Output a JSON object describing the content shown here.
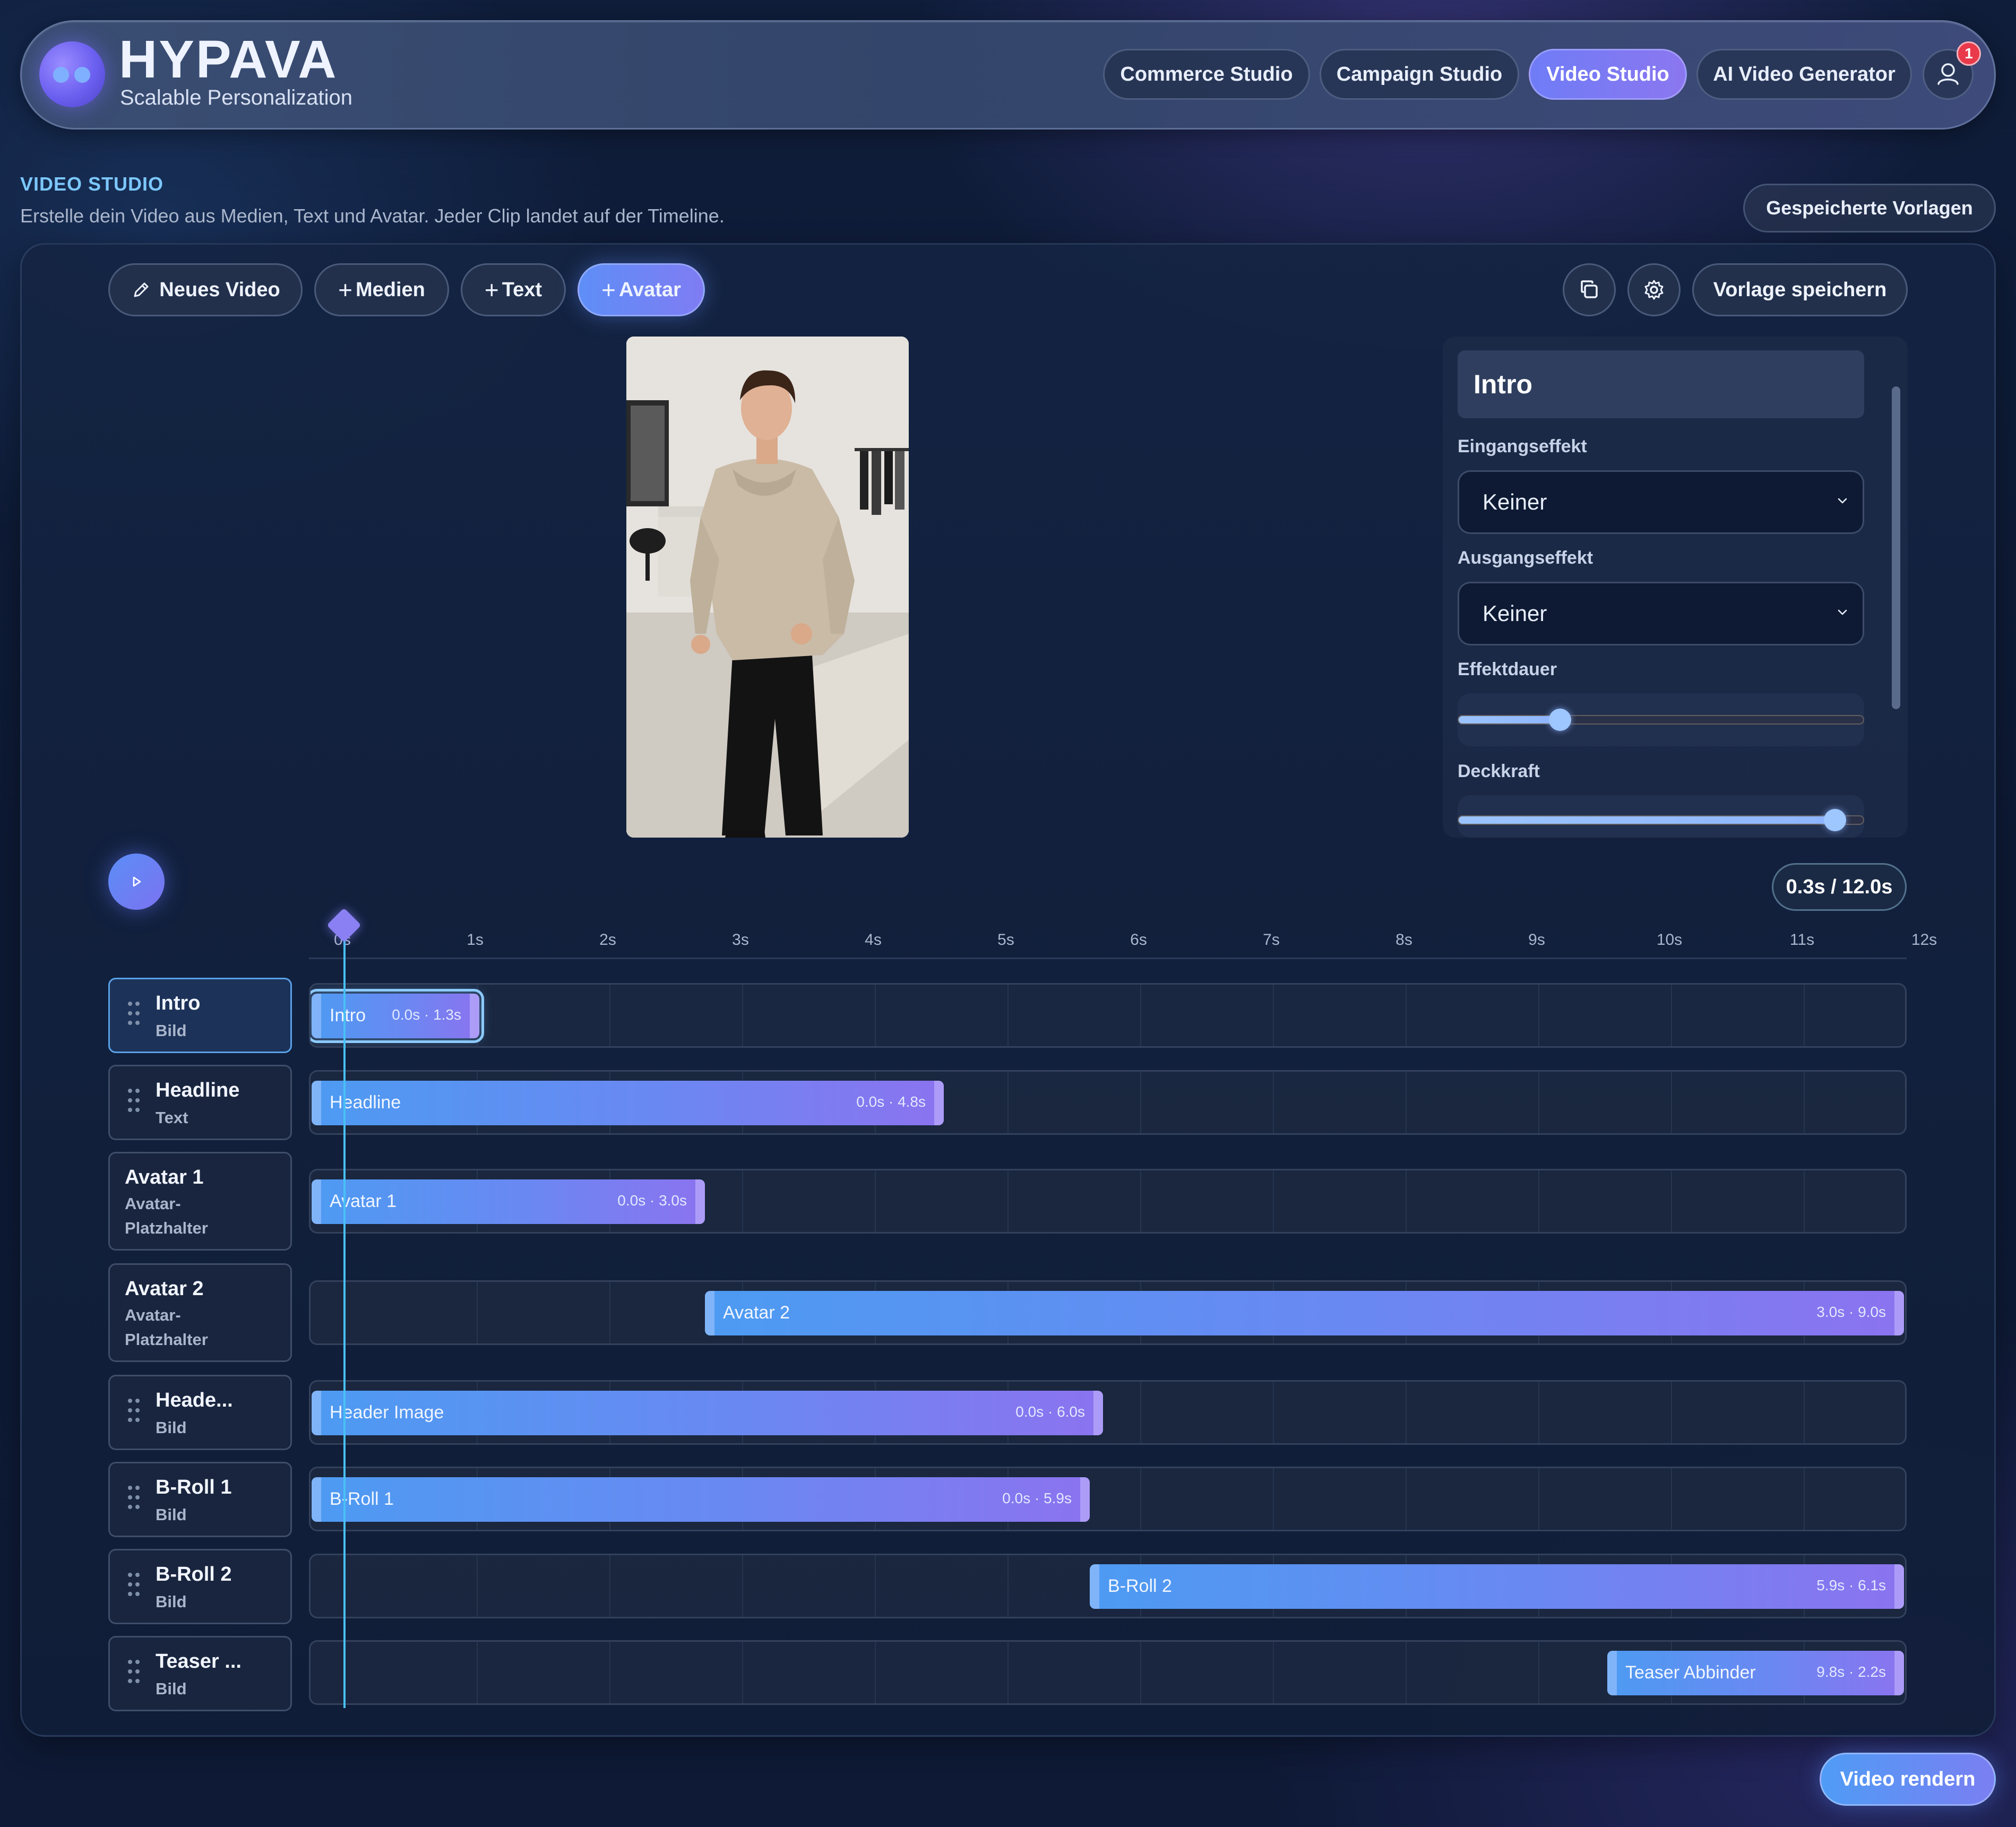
{
  "brand": {
    "name": "HYPAVA",
    "tagline": "Scalable Personalization"
  },
  "nav": {
    "items": [
      "Commerce Studio",
      "Campaign Studio",
      "Video Studio",
      "AI Video Generator"
    ],
    "active": "Video Studio",
    "notification_count": "1"
  },
  "section": {
    "title": "VIDEO STUDIO",
    "subtitle": "Erstelle dein Video aus Medien, Text und Avatar. Jeder Clip landet auf der Timeline.",
    "saved_templates": "Gespeicherte Vorlagen"
  },
  "toolbar": {
    "new_video": "Neues Video",
    "media": "Medien",
    "text": "Text",
    "avatar": "Avatar",
    "save_template": "Vorlage speichern",
    "icons": [
      "copy-icon",
      "gear-icon"
    ]
  },
  "settings": {
    "title": "Intro",
    "entry_effect_label": "Eingangseffekt",
    "entry_effect_value": "Keiner",
    "exit_effect_label": "Ausgangseffekt",
    "exit_effect_value": "Keiner",
    "effect_duration_label": "Effektdauer",
    "effect_duration_fraction": 0.25,
    "opacity_label": "Deckkraft",
    "opacity_fraction": 0.93
  },
  "player": {
    "time": "0.3s / 12.0s"
  },
  "ruler": {
    "ticks": [
      "0s",
      "1s",
      "2s",
      "3s",
      "4s",
      "5s",
      "6s",
      "7s",
      "8s",
      "9s",
      "10s",
      "11s",
      "12s"
    ]
  },
  "tracks": [
    {
      "name": "Intro",
      "type": "Bild",
      "clip": "Intro",
      "timing": "0.0s · 1.3s",
      "start": 0.0,
      "duration": 1.3
    },
    {
      "name": "Headline",
      "type": "Text",
      "clip": "Headline",
      "timing": "0.0s · 4.8s",
      "start": 0.0,
      "duration": 4.8
    },
    {
      "name": "Avatar 1",
      "type": "Avatar-Platzhalter",
      "clip": "Avatar 1",
      "timing": "0.0s · 3.0s",
      "start": 0.0,
      "duration": 3.0
    },
    {
      "name": "Avatar 2",
      "type": "Avatar-Platzhalter",
      "clip": "Avatar 2",
      "timing": "3.0s · 9.0s",
      "start": 3.0,
      "duration": 9.0
    },
    {
      "name": "Heade...",
      "type": "Bild",
      "clip": "Header Image",
      "timing": "0.0s · 6.0s",
      "start": 0.0,
      "duration": 6.0
    },
    {
      "name": "B-Roll 1",
      "type": "Bild",
      "clip": "B-Roll 1",
      "timing": "0.0s · 5.9s",
      "start": 0.0,
      "duration": 5.9
    },
    {
      "name": "B-Roll 2",
      "type": "Bild",
      "clip": "B-Roll 2",
      "timing": "5.9s · 6.1s",
      "start": 5.9,
      "duration": 6.1
    },
    {
      "name": "Teaser ...",
      "type": "Bild",
      "clip": "Teaser Abbinder",
      "timing": "9.8s · 2.2s",
      "start": 9.8,
      "duration": 2.2
    }
  ],
  "render_button": "Video rendern"
}
